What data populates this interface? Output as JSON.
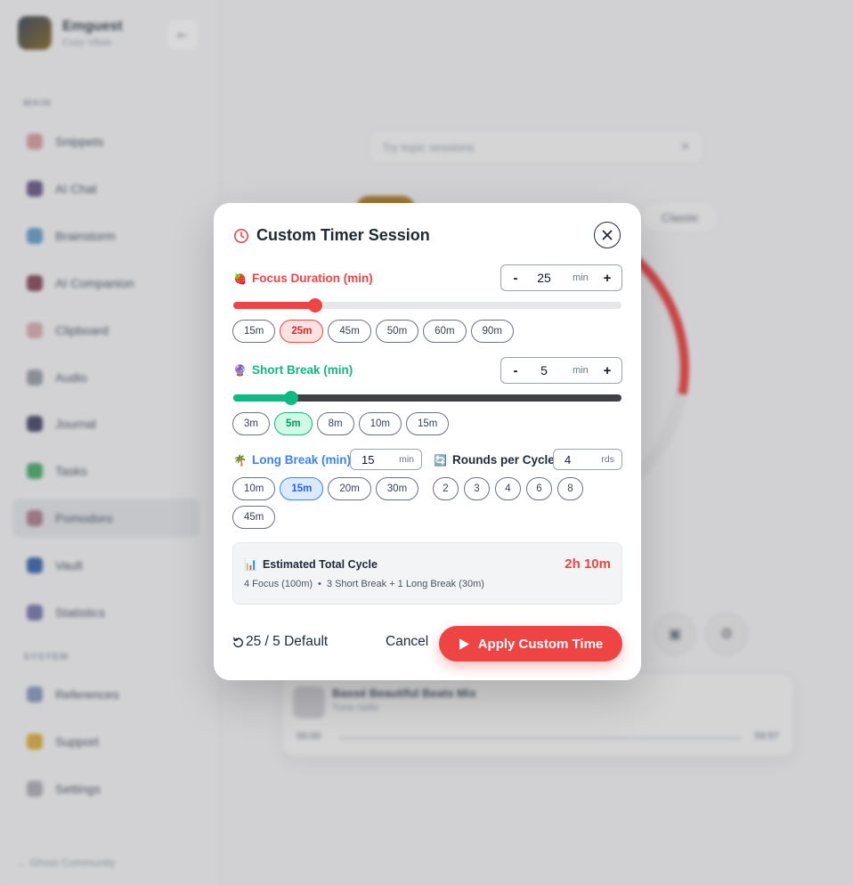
{
  "background": {
    "brand": {
      "name": "Emguest",
      "subtitle": "Cozy Vibes"
    },
    "nav_section_main": "MAIN",
    "nav_items": [
      {
        "label": "Snippets",
        "color": "#d9a0a0"
      },
      {
        "label": "AI Chat",
        "color": "#6b5b8a"
      },
      {
        "label": "Brainstorm",
        "color": "#6aa0c8"
      },
      {
        "label": "AI Companion",
        "color": "#8a4a5a"
      },
      {
        "label": "Clipboard",
        "color": "#d9b0b0"
      },
      {
        "label": "Audio",
        "color": "#9aa0a8"
      },
      {
        "label": "Journal",
        "color": "#4a4a6a"
      },
      {
        "label": "Tasks",
        "color": "#4caf6a"
      },
      {
        "label": "Pomodoro",
        "color": "#b08090"
      },
      {
        "label": "Vault",
        "color": "#3a6ab0"
      },
      {
        "label": "Statistics",
        "color": "#7a7ab0"
      }
    ],
    "nav_section_system": "SYSTEM",
    "system_items": [
      {
        "label": "References",
        "color": "#8a9ac0"
      },
      {
        "label": "Support",
        "color": "#e0b040"
      },
      {
        "label": "Settings",
        "color": "#b0b0b8"
      }
    ],
    "footer": "Ghost Community",
    "search_placeholder": "Try topic sessions",
    "pill_label": "Classic",
    "player": {
      "title": "Bassé Beautiful Beats Mix",
      "subtitle": "Tune radio",
      "time_start": "00:00",
      "time_end": "59:57"
    }
  },
  "modal": {
    "title": "Custom Timer Session",
    "focus": {
      "emoji": "🍓",
      "label": "Focus Duration (min)",
      "value": "25",
      "unit": "min",
      "level": 0.21,
      "presets": [
        "15m",
        "25m",
        "45m",
        "50m",
        "60m",
        "90m"
      ],
      "selected": "25m"
    },
    "short_break": {
      "emoji": "🔮",
      "label": "Short Break (min)",
      "value": "5",
      "unit": "min",
      "level": 0.15,
      "presets": [
        "3m",
        "5m",
        "8m",
        "10m",
        "15m"
      ],
      "selected": "5m"
    },
    "long_break": {
      "emoji": "🌴",
      "label": "Long Break (min)",
      "value": "15",
      "unit": "min",
      "presets": [
        "10m",
        "15m",
        "20m",
        "30m",
        "45m"
      ],
      "selected": "15m"
    },
    "rounds": {
      "emoji": "🔄",
      "label": "Rounds per Cycle",
      "value": "4",
      "unit": "rds",
      "presets": [
        "2",
        "3",
        "4",
        "6",
        "8"
      ]
    },
    "summary": {
      "emoji": "📊",
      "title": "Estimated Total Cycle",
      "total": "2h 10m",
      "focus_part": "4 Focus (100m)",
      "bullet": "•",
      "break_part": "3 Short Break + 1 Long Break (30m)"
    },
    "reset_label": "25 / 5 Default",
    "cancel_label": "Cancel",
    "apply_label": "Apply Custom Time",
    "stepper_minus": "-",
    "stepper_plus": "+",
    "colors": {
      "focus": "#ef4444",
      "short": "#10b981",
      "long": "#3b82f6",
      "accent": "#ef4444"
    }
  }
}
